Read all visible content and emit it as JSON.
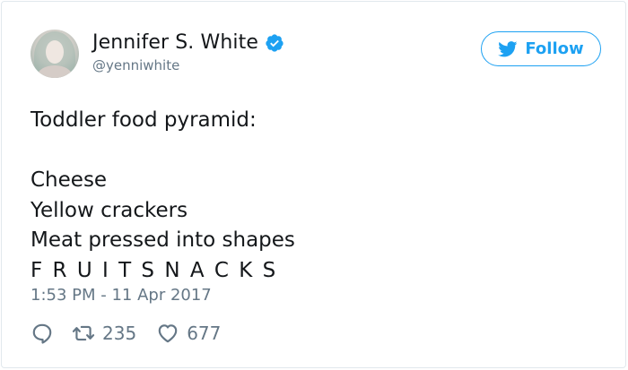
{
  "author": {
    "display_name": "Jennifer S. White",
    "handle": "@yenniwhite",
    "verified": true
  },
  "follow_button": {
    "label": "Follow"
  },
  "tweet": {
    "lines": [
      "Toddler food pyramid:",
      "",
      "Cheese",
      "Yellow crackers",
      "Meat pressed into shapes",
      "F R U I T S N A C K S"
    ],
    "timestamp": "1:53 PM - 11 Apr 2017"
  },
  "actions": {
    "retweets": "235",
    "likes": "677"
  },
  "colors": {
    "accent": "#1da1f2",
    "muted": "#657786",
    "text": "#14171a",
    "border": "#e1e8ed"
  }
}
